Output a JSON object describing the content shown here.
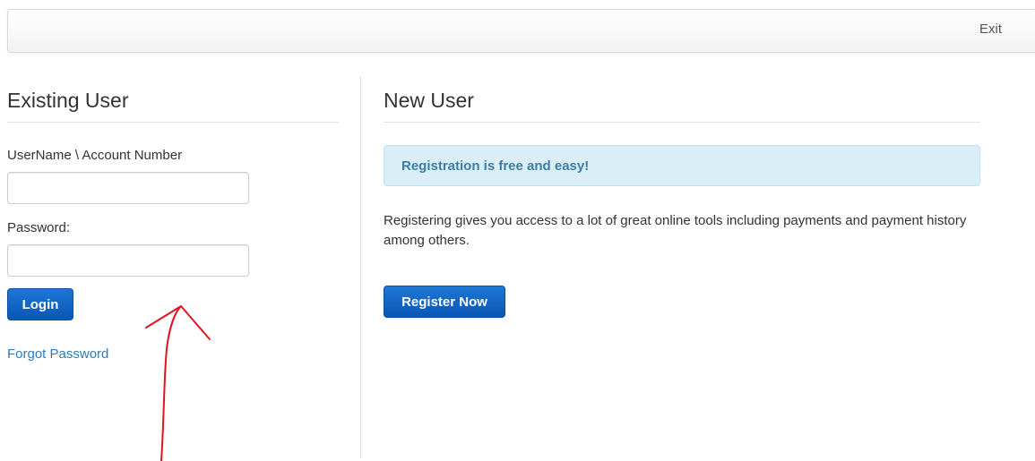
{
  "header": {
    "exit_label": "Exit"
  },
  "existing_user": {
    "title": "Existing User",
    "username_label": "UserName \\ Account Number",
    "username_value": "",
    "password_label": "Password:",
    "password_value": "",
    "login_label": "Login",
    "forgot_password_label": "Forgot Password"
  },
  "new_user": {
    "title": "New User",
    "alert_text": "Registration is free and easy!",
    "description": "Registering gives you access to a lot of great online tools including payments and payment history among others.",
    "register_label": "Register Now"
  },
  "colors": {
    "primary_button": "#0a56b5",
    "link": "#2a7bc0",
    "alert_background": "#d9eef7",
    "annotation_arrow": "#e0141e"
  }
}
